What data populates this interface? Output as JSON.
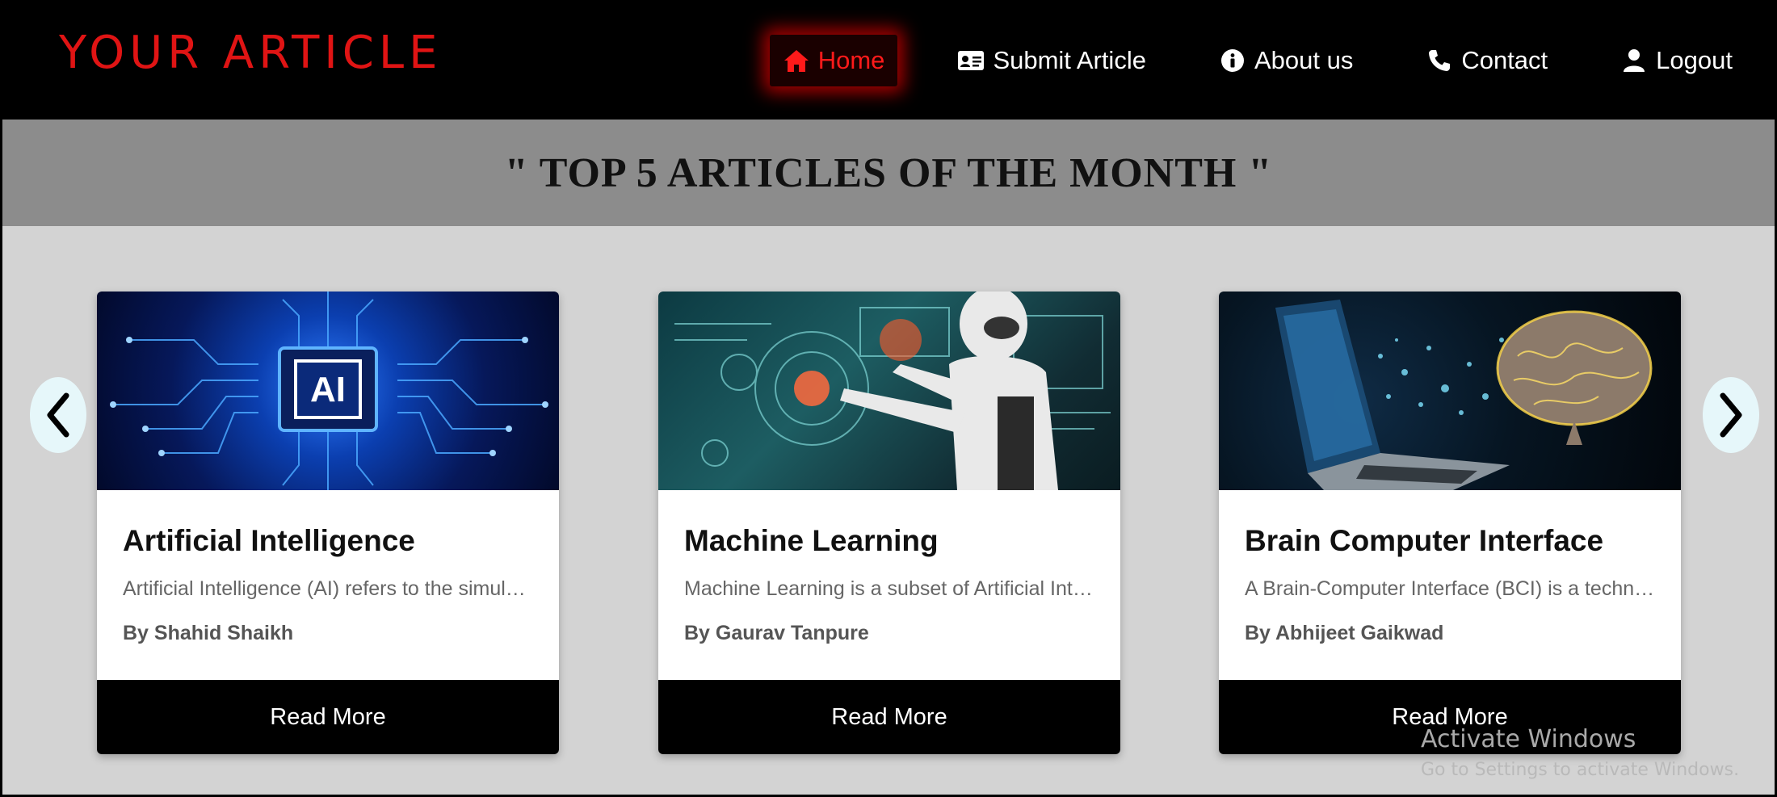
{
  "brand": "YOUR ARTICLE",
  "nav": [
    {
      "label": "Home",
      "icon": "home-icon",
      "active": true
    },
    {
      "label": "Submit Article",
      "icon": "id-card-icon",
      "active": false
    },
    {
      "label": "About us",
      "icon": "info-icon",
      "active": false
    },
    {
      "label": "Contact",
      "icon": "phone-icon",
      "active": false
    },
    {
      "label": "Logout",
      "icon": "user-icon",
      "active": false
    }
  ],
  "section_title": "\" TOP 5 ARTICLES OF THE MONTH \"",
  "cards": [
    {
      "title": "Artificial Intelligence",
      "description": "Artificial Intelligence (AI) refers to the simulation of human intelligence",
      "author": "By Shahid Shaikh",
      "button": "Read More",
      "image_label": "AI"
    },
    {
      "title": "Machine Learning",
      "description": "Machine Learning is a subset of Artificial Intelligence",
      "author": "By Gaurav Tanpure",
      "button": "Read More"
    },
    {
      "title": "Brain Computer Interface",
      "description": "A Brain-Computer Interface (BCI) is a technology",
      "author": "By Abhijeet Gaikwad",
      "button": "Read More"
    }
  ],
  "watermark": {
    "line1": "Activate Windows",
    "line2": "Go to Settings to activate Windows."
  },
  "colors": {
    "brand": "#e01414",
    "header_bg": "#000000",
    "title_band": "#8c8c8c",
    "page_bg": "#d3d3d3",
    "active_glow": "#ff1a1a"
  }
}
